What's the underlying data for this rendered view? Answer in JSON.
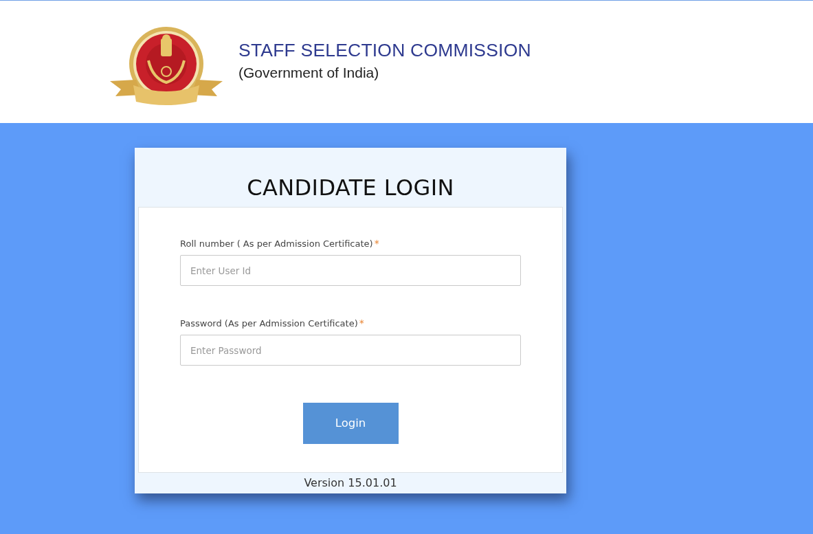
{
  "header": {
    "title": "STAFF SELECTION COMMISSION",
    "subtitle": "(Government of India)"
  },
  "login": {
    "title": "CANDIDATE LOGIN",
    "fields": [
      {
        "label": "Roll number ( As per Admission Certificate)",
        "required_mark": "*",
        "placeholder": "Enter User Id"
      },
      {
        "label": "Password (As per Admission Certificate)",
        "required_mark": "*",
        "placeholder": "Enter Password"
      }
    ],
    "button": "Login",
    "version": "Version 15.01.01"
  }
}
